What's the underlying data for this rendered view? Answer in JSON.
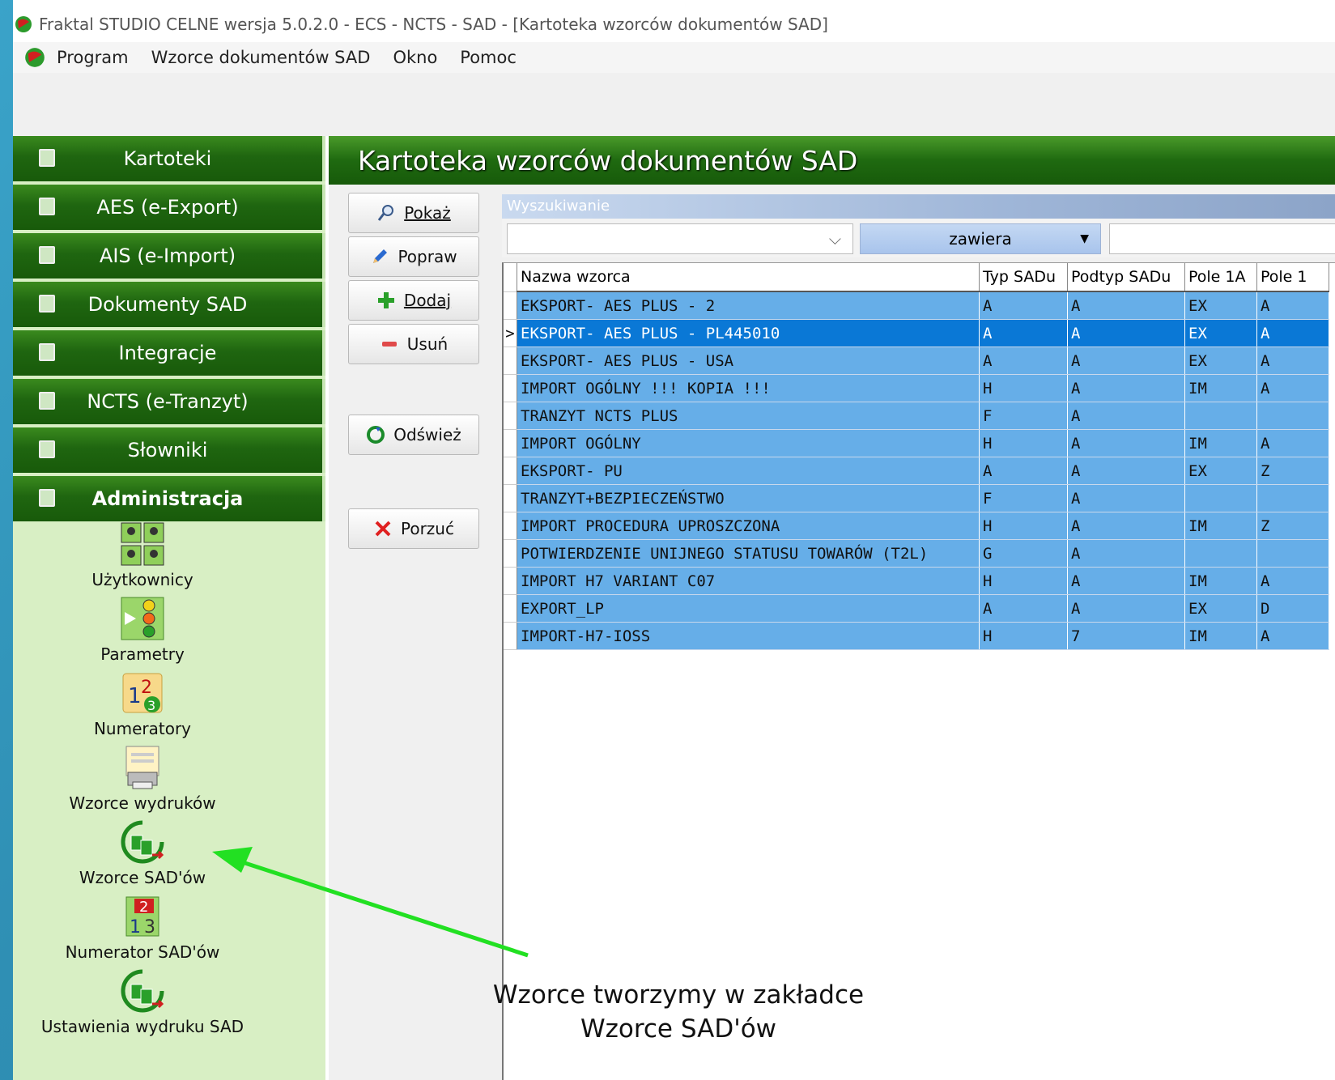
{
  "window": {
    "title": "Fraktal STUDIO CELNE  wersja 5.0.2.0 - ECS - NCTS - SAD - [Kartoteka wzorców dokumentów SAD]"
  },
  "menubar": {
    "items": [
      "Program",
      "Wzorce dokumentów SAD",
      "Okno",
      "Pomoc"
    ]
  },
  "sidebar": {
    "nav": [
      {
        "label": "Kartoteki",
        "icon": "folder-icon"
      },
      {
        "label": "AES (e-Export)",
        "icon": "export-truck-icon"
      },
      {
        "label": "AIS (e-Import)",
        "icon": "import-truck-icon"
      },
      {
        "label": "Dokumenty SAD",
        "icon": "document-icon"
      },
      {
        "label": "Integracje",
        "icon": "integration-icon"
      },
      {
        "label": "NCTS (e-Tranzyt)",
        "icon": "mail-icon"
      },
      {
        "label": "Słowniki",
        "icon": "dictionary-icon"
      },
      {
        "label": "Administracja",
        "icon": "tools-icon"
      }
    ],
    "tools": [
      {
        "label": "Użytkownicy",
        "icon": "users-icon"
      },
      {
        "label": "Parametry",
        "icon": "parameters-icon"
      },
      {
        "label": "Numeratory",
        "icon": "numerators-icon"
      },
      {
        "label": "Wzorce wydruków",
        "icon": "print-templates-icon"
      },
      {
        "label": "Wzorce SAD'ów",
        "icon": "sad-templates-icon"
      },
      {
        "label": "Numerator SAD'ów",
        "icon": "sad-numerator-icon"
      },
      {
        "label": "Ustawienia wydruku SAD",
        "icon": "sad-print-settings-icon"
      }
    ]
  },
  "main": {
    "header": "Kartoteka wzorców dokumentów SAD",
    "buttons": {
      "show": "Pokaż",
      "edit": "Popraw",
      "add": "Dodaj",
      "delete": "Usuń",
      "refresh": "Odśwież",
      "cancel": "Porzuć"
    },
    "search": {
      "caption": "Wyszukiwanie",
      "field_value": "",
      "mode": "zawiera",
      "query": ""
    },
    "table": {
      "columns": [
        "Nazwa wzorca",
        "Typ SADu",
        "Podtyp SADu",
        "Pole 1A",
        "Pole 1"
      ],
      "rows": [
        [
          "EKSPORT- AES PLUS - 2",
          "A",
          "A",
          "EX",
          "A"
        ],
        [
          "EKSPORT- AES PLUS - PL445010",
          "A",
          "A",
          "EX",
          "A"
        ],
        [
          "EKSPORT- AES PLUS - USA",
          "A",
          "A",
          "EX",
          "A"
        ],
        [
          "IMPORT OGÓLNY !!! KOPIA !!!",
          "H",
          "A",
          "IM",
          "A"
        ],
        [
          "TRANZYT NCTS PLUS",
          "F",
          "A",
          "",
          ""
        ],
        [
          "IMPORT OGÓLNY",
          "H",
          "A",
          "IM",
          "A"
        ],
        [
          "EKSPORT- PU",
          "A",
          "A",
          "EX",
          "Z"
        ],
        [
          "TRANZYT+BEZPIECZEŃSTWO",
          "F",
          "A",
          "",
          ""
        ],
        [
          "IMPORT PROCEDURA UPROSZCZONA",
          "H",
          "A",
          "IM",
          "Z"
        ],
        [
          "POTWIERDZENIE UNIJNEGO STATUSU TOWARÓW (T2L)",
          "G",
          "A",
          "",
          ""
        ],
        [
          "IMPORT H7 VARIANT C07",
          "H",
          "A",
          "IM",
          "A"
        ],
        [
          "EXPORT_LP",
          "A",
          "A",
          "EX",
          "D"
        ],
        [
          "IMPORT-H7-IOSS",
          "H",
          "7",
          "IM",
          "A"
        ]
      ],
      "selected_row": 1,
      "row_indicator": ">"
    }
  },
  "annotation": {
    "line1": "Wzorce tworzymy w zakładce",
    "line2": "Wzorce SAD'ów"
  },
  "colors": {
    "nav_green": "#1f6610",
    "sidebar_bg": "#d8efc4",
    "row_blue": "#66aee8",
    "selected_blue": "#0a78d6",
    "arrow_green": "#22e022"
  }
}
